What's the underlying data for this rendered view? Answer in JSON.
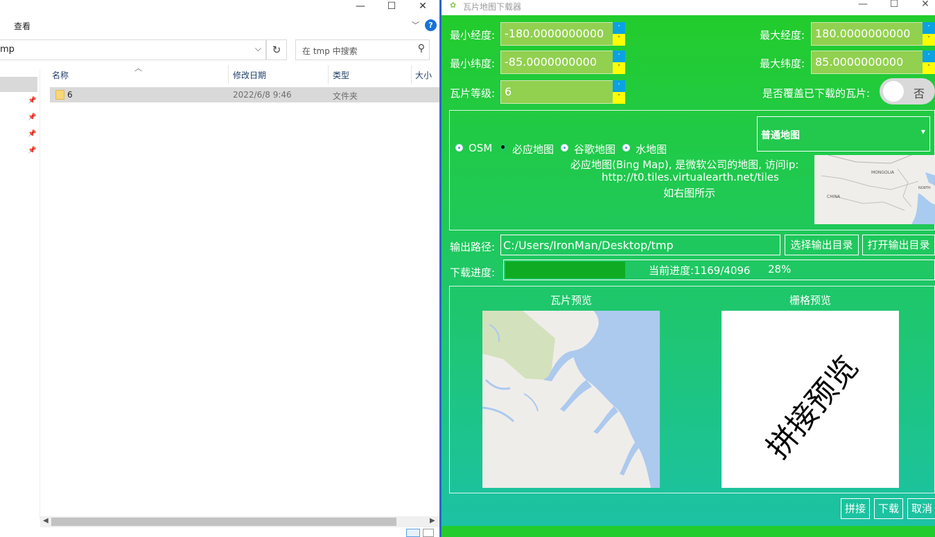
{
  "explorer": {
    "window_buttons": {
      "minimize": "—",
      "maximize": "☐",
      "close": "✕"
    },
    "ribbon_tab": "查看",
    "address": "mp",
    "search_placeholder": "在 tmp 中搜索",
    "columns": [
      "名称",
      "修改日期",
      "类型",
      "大小"
    ],
    "rows": [
      {
        "name": "6",
        "date": "2022/6/8 9:46",
        "type": "文件夹"
      }
    ]
  },
  "app": {
    "title": "瓦片地图下载器",
    "min_lng_label": "最小经度:",
    "min_lng_value": "-180.0000000000",
    "max_lng_label": "最大经度:",
    "max_lng_value": "180.0000000000",
    "min_lat_label": "最小纬度:",
    "min_lat_value": "-85.0000000000",
    "max_lat_label": "最大纬度:",
    "max_lat_value": "85.0000000000",
    "zoom_label": "瓦片等级:",
    "zoom_value": "6",
    "overwrite_label": "是否覆盖已下载的瓦片:",
    "overwrite_toggle": "否",
    "sources": [
      {
        "label": "OSM",
        "selected": false
      },
      {
        "label": "必应地图",
        "selected": true
      },
      {
        "label": "谷歌地图",
        "selected": false
      },
      {
        "label": "水地图",
        "selected": false
      }
    ],
    "map_type": "普通地图",
    "desc_line1": "必应地图(Bing Map), 是微软公司的地图, 访问ip:",
    "desc_line2": "http://t0.tiles.virtualearth.net/tiles",
    "desc_line3": "如右图所示",
    "thumb_labels": [
      "MONGOLIA",
      "CHINA",
      "NORTH"
    ],
    "output_label": "输出路径:",
    "output_path": "C:/Users/IronMan/Desktop/tmp",
    "choose_output_btn": "选择输出目录",
    "open_output_btn": "打开输出目录",
    "progress_label": "下载进度:",
    "progress_text": "当前进度:1169/4096",
    "progress_percent": "28%",
    "progress_fraction": 0.28,
    "tile_preview_title": "瓦片预览",
    "grid_preview_title": "栅格预览",
    "grid_preview_text": "拼接预览",
    "merge_btn": "拼接",
    "download_btn": "下载",
    "cancel_btn": "取消"
  },
  "colors": {
    "accent_green": "#22cc2c",
    "input_green": "#92d050",
    "spin_up": "#0aa2e3",
    "spin_down": "#ffff00",
    "progress_fill": "#0fab22"
  }
}
